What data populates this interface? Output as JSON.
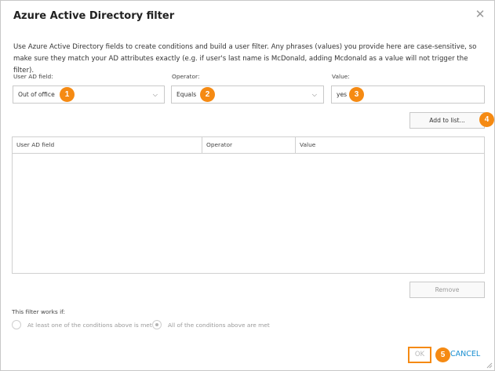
{
  "dialog": {
    "title": "Azure Active Directory filter",
    "close_icon": "close-icon",
    "description": "Use Azure Active Directory fields to create conditions and build a user filter. Any phrases (values) you provide here are case-sensitive, so make sure they match your AD attributes exactly (e.g. if user's last name is McDonald, adding Mcdonald as a value will not trigger the filter)."
  },
  "form": {
    "field_label": "User AD field:",
    "field_value": "Out of office",
    "operator_label": "Operator:",
    "operator_value": "Equals",
    "value_label": "Value:",
    "value_value": "yes",
    "add_button": "Add to list..."
  },
  "table": {
    "columns": [
      "User AD field",
      "Operator",
      "Value"
    ],
    "rows": []
  },
  "remove_button": "Remove",
  "filter_works_if": {
    "label": "This filter works if:",
    "options": [
      {
        "label": "At least one of the conditions above is met",
        "selected": false
      },
      {
        "label": "All of the conditions above are met",
        "selected": true
      }
    ]
  },
  "footer": {
    "ok": "OK",
    "cancel": "CANCEL"
  },
  "callouts": [
    "1",
    "2",
    "3",
    "4",
    "5"
  ],
  "colors": {
    "callout": "#f58a13",
    "link": "#1a8fd1",
    "border": "#c9c9c9"
  }
}
